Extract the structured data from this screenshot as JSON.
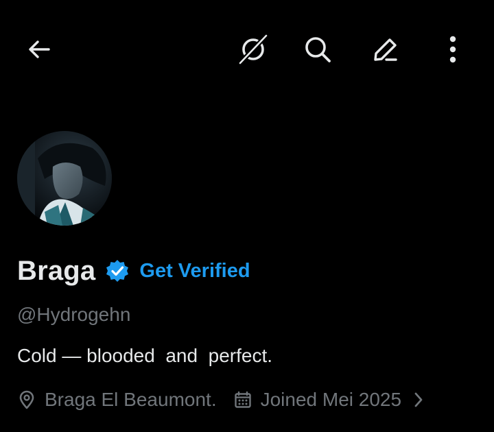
{
  "header": {
    "icons": [
      "back-arrow-icon",
      "grok-icon",
      "search-icon",
      "edit-icon",
      "more-vertical-icon"
    ]
  },
  "profile": {
    "avatar_alt": "avatar",
    "display_name": "Braga",
    "verified_icon": "verified-badge-icon",
    "get_verified_label": "Get Verified",
    "handle": "@Hydrogehn",
    "bio": "Cold — blooded  and  perfect.",
    "location": "Braga El Beaumont.",
    "joined": "Joined Mei 2025"
  },
  "colors": {
    "background": "#000000",
    "text_primary": "#e7e9ea",
    "text_secondary": "#71767b",
    "accent": "#1d9bf0"
  }
}
